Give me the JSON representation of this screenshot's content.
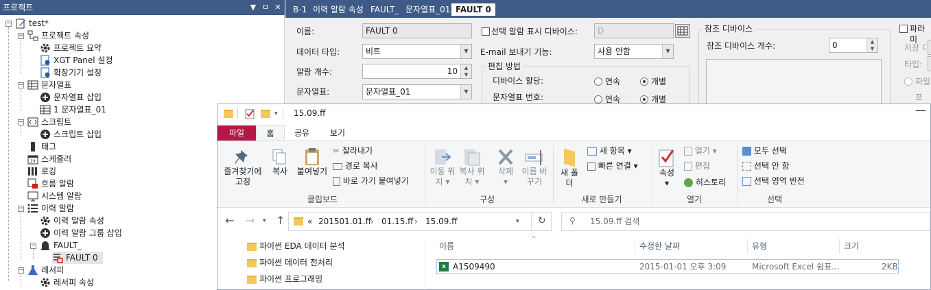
{
  "project_panel": {
    "title": "프로젝트",
    "pin": "ㅁ",
    "close": "✕",
    "dropdown": "▼",
    "tree": [
      {
        "label": "test*"
      },
      {
        "label": "프로젝트 속성"
      },
      {
        "label": "프로젝트 요약"
      },
      {
        "label": "XGT Panel 설정"
      },
      {
        "label": "확장기기 설정"
      },
      {
        "label": "문자열표"
      },
      {
        "label": "문자열표 삽입"
      },
      {
        "label": "1 문자열표_01"
      },
      {
        "label": "스크립트"
      },
      {
        "label": "스크립트 삽입"
      },
      {
        "label": "태그"
      },
      {
        "label": "스케줄러"
      },
      {
        "label": "로깅"
      },
      {
        "label": "흐름 알람"
      },
      {
        "label": "시스템 알람"
      },
      {
        "label": "이력 알람"
      },
      {
        "label": "이력 알람 속성"
      },
      {
        "label": "이력 알람 그룹 삽입"
      },
      {
        "label": "FAULT_"
      },
      {
        "label": "FAULT 0"
      },
      {
        "label": "레서피"
      },
      {
        "label": "레서피 속성"
      }
    ]
  },
  "editor": {
    "tabs": [
      "B-1",
      "이력 알람 속성",
      "FAULT_",
      "문자열표_01",
      "FAULT 0"
    ],
    "name_label": "이름:",
    "name_value": "FAULT 0",
    "data_type_label": "데이터 타입:",
    "data_type_value": "비트",
    "alarm_count_label": "알람 개수:",
    "alarm_count_value": "10",
    "string_table_label": "문자열표:",
    "string_table_value": "문자열표_01",
    "select_alarm_display_label": "선택 알람 표시 디바이스:",
    "select_alarm_display_value": "D",
    "email_label": "E-mail 보내기 기능:",
    "email_value": "사용 안함",
    "edit_method_group": "편집 방법",
    "device_assign_label": "디바이스 할당:",
    "string_number_label": "문자열표 번호:",
    "opt_continuous": "연속",
    "opt_individual": "개별",
    "ref_device_group": "참조 디바이스",
    "ref_device_count_label": "참조 디바이스 개수:",
    "ref_device_count_value": "0",
    "param_label": "파라미",
    "save_label": "저장 디",
    "type_label": "타입:",
    "file_label": "파일",
    "pho_label": "포"
  },
  "explorer": {
    "title": "15.09.ff",
    "ribbon_tabs": [
      "파일",
      "홈",
      "공유",
      "보기"
    ],
    "clipboard": {
      "pin": "즐겨찾기에 고정",
      "copy": "복사",
      "paste": "붙여넣기",
      "cut": "잘라내기",
      "copy_path": "경로 복사",
      "paste_shortcut": "바로 가기 붙여넣기",
      "group": "클립보드"
    },
    "organize": {
      "move_to": "이동 위치",
      "copy_to": "복사 위치",
      "delete": "삭제",
      "rename": "이름 바꾸기",
      "group": "구성"
    },
    "new": {
      "new_folder": "새 폴더",
      "new_item": "새 항목",
      "easy_access": "빠른 연결",
      "group": "새로 만들기"
    },
    "open": {
      "properties": "속성",
      "open": "열기",
      "edit": "편집",
      "history": "히스토리",
      "group": "열기"
    },
    "select": {
      "select_all": "모두 선택",
      "select_none": "선택 안 함",
      "invert": "선택 영역 반전",
      "group": "선택"
    },
    "breadcrumb": [
      "«",
      "201501.01.ff",
      "01.15.ff",
      "15.09.ff"
    ],
    "search_placeholder": "15.09.ff 검색",
    "nav_items": [
      "파이썬 EDA 데이터 분석",
      "파이썬 데이터 전처리",
      "파이썬 프로그래밍"
    ],
    "columns": [
      "이름",
      "수정한 날짜",
      "유형",
      "크기"
    ],
    "files": [
      {
        "name": "A1509490",
        "modified": "2015-01-01 오후 3:09",
        "type": "Microsoft Excel 쉼표...",
        "size": "2KB"
      }
    ]
  }
}
